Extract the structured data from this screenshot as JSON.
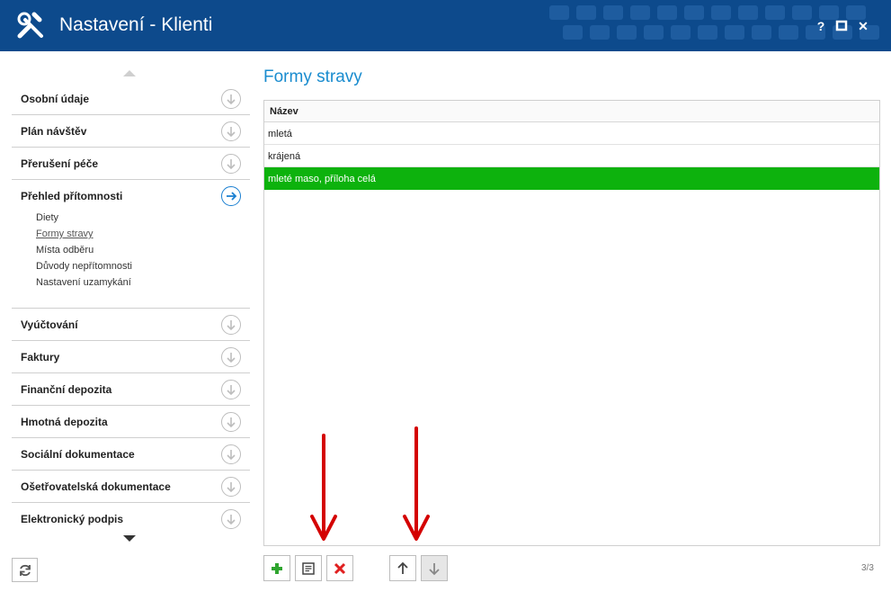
{
  "window": {
    "title": "Nastavení - Klienti",
    "controls": {
      "help": "?",
      "maximize": "maximize-icon",
      "close": "✕"
    }
  },
  "sidebar": {
    "items": [
      {
        "label": "Osobní údaje"
      },
      {
        "label": "Plán návštěv"
      },
      {
        "label": "Přerušení péče"
      },
      {
        "label": "Přehled přítomnosti",
        "active": true
      }
    ],
    "subitems": [
      "Diety",
      "Formy stravy",
      "Místa odběru",
      "Důvody nepřítomnosti",
      "Nastavení uzamykání"
    ],
    "current_subitem": "Formy stravy",
    "items_after": [
      {
        "label": "Vyúčtování"
      },
      {
        "label": "Faktury"
      },
      {
        "label": "Finanční depozita"
      },
      {
        "label": "Hmotná depozita"
      },
      {
        "label": "Sociální dokumentace"
      },
      {
        "label": "Ošetřovatelská dokumentace"
      },
      {
        "label": "Elektronický podpis"
      }
    ]
  },
  "main": {
    "title": "Formy stravy",
    "table": {
      "column": "Název",
      "rows": [
        "mletá",
        "krájená",
        "mleté maso, příloha celá"
      ],
      "selected_row": 2
    },
    "record_count": "3/3"
  },
  "colors": {
    "titlebar": "#0d4a8c",
    "accent": "#1a8ccf",
    "selected_row": "#0db20d",
    "add": "#2fa52f",
    "delete": "#e02020",
    "annotation": "#d40000"
  }
}
